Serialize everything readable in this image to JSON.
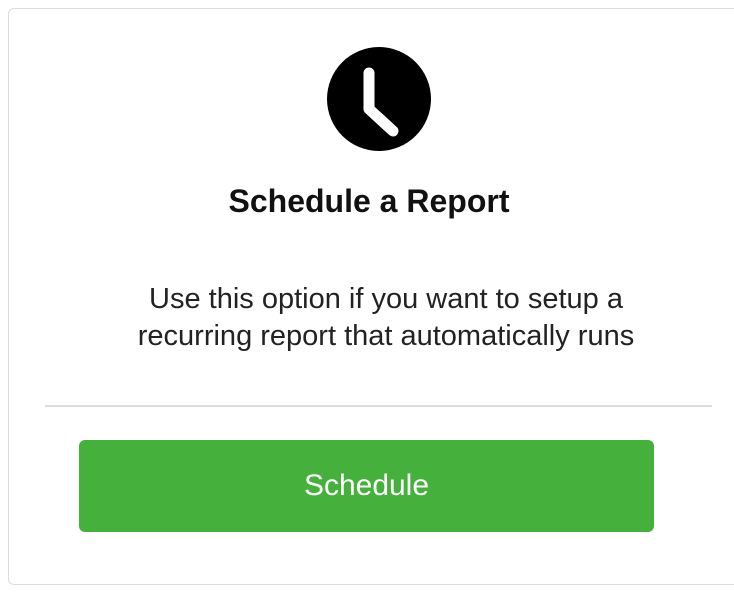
{
  "card": {
    "icon": "clock-icon",
    "title": "Schedule a Report",
    "description_lines": [
      "Use this option if you want to setup a",
      "recurring report that automatically runs"
    ],
    "button_label": "Schedule"
  },
  "colors": {
    "button": "#45b03b",
    "icon": "#000000"
  }
}
